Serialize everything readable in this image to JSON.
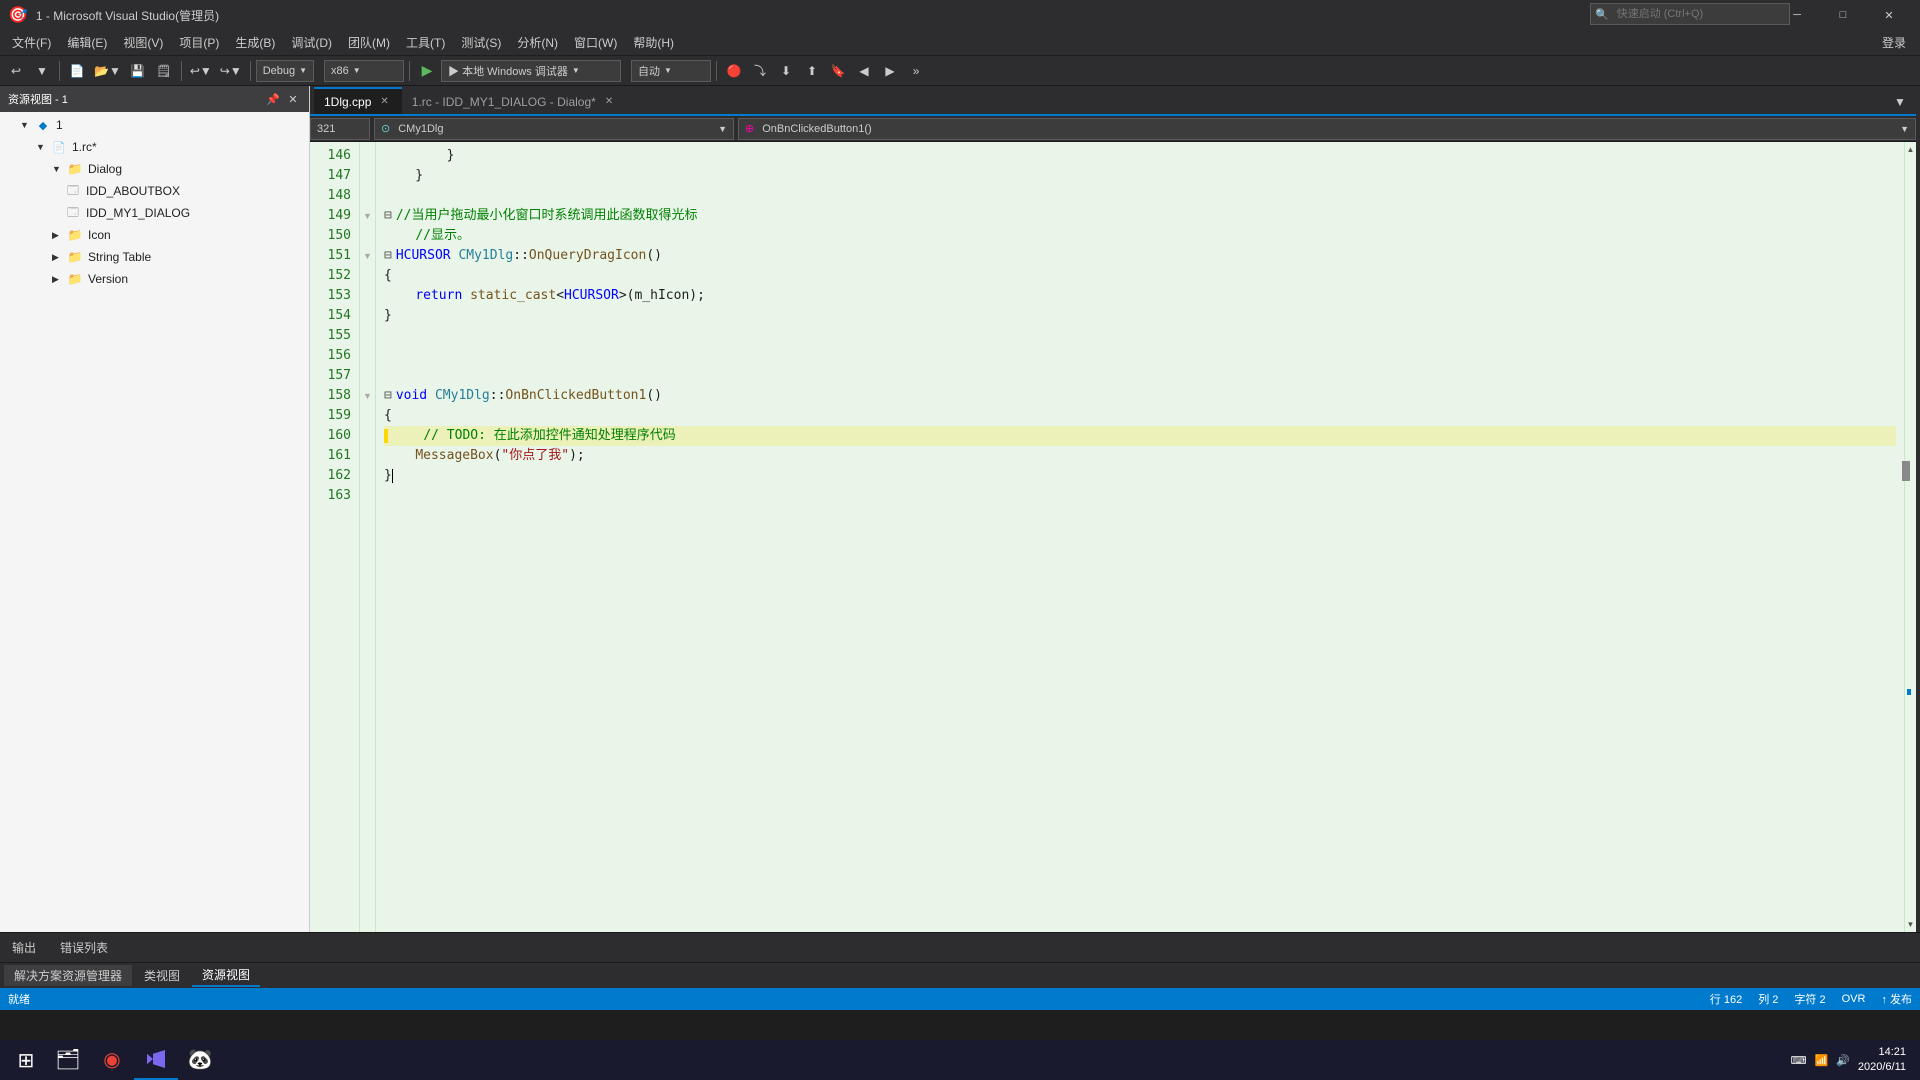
{
  "titleBar": {
    "icon": "▶",
    "title": "1 - Microsoft Visual Studio(管理员)",
    "quickLaunch": "快速启动 (Ctrl+Q)",
    "minimize": "─",
    "maximize": "□",
    "close": "✕"
  },
  "menuBar": {
    "items": [
      "文件(F)",
      "编辑(E)",
      "视图(V)",
      "项目(P)",
      "生成(B)",
      "调试(D)",
      "团队(M)",
      "工具(T)",
      "测试(S)",
      "分析(N)",
      "窗口(W)",
      "帮助(H)"
    ],
    "loginLabel": "登录"
  },
  "toolbar": {
    "debugMode": "Debug",
    "platform": "x86",
    "startLabel": "▶ 本地 Windows 调试器",
    "autoLabel": "自动"
  },
  "sidebar": {
    "title": "资源视图 - 1",
    "tree": [
      {
        "id": "root",
        "label": "1",
        "indent": 0,
        "expanded": true,
        "icon": "📁"
      },
      {
        "id": "rc",
        "label": "1.rc*",
        "indent": 1,
        "expanded": true,
        "icon": "📄"
      },
      {
        "id": "dialog",
        "label": "Dialog",
        "indent": 2,
        "expanded": true,
        "icon": "📁"
      },
      {
        "id": "idd_about",
        "label": "IDD_ABOUTBOX",
        "indent": 3,
        "expanded": false,
        "icon": "🗔"
      },
      {
        "id": "idd_my1",
        "label": "IDD_MY1_DIALOG",
        "indent": 3,
        "expanded": false,
        "icon": "🗔"
      },
      {
        "id": "icon",
        "label": "Icon",
        "indent": 2,
        "expanded": false,
        "icon": "📁"
      },
      {
        "id": "stringtable",
        "label": "String Table",
        "indent": 2,
        "expanded": false,
        "icon": "📁"
      },
      {
        "id": "version",
        "label": "Version",
        "indent": 2,
        "expanded": false,
        "icon": "📁"
      }
    ]
  },
  "tabs": [
    {
      "id": "1dlg",
      "label": "1Dlg.cpp",
      "active": true,
      "modified": false
    },
    {
      "id": "1rc",
      "label": "1.rc - IDD_MY1_DIALOG - Dialog*",
      "active": false,
      "modified": true
    }
  ],
  "navDropdowns": {
    "lineNum": "321",
    "classDropdown": "CMy1Dlg",
    "methodDropdown": "OnBnClickedButton1()"
  },
  "codeEditor": {
    "lines": [
      {
        "num": 146,
        "indent": "        ",
        "content": "}"
      },
      {
        "num": 147,
        "indent": "    ",
        "content": "}"
      },
      {
        "num": 148,
        "indent": "",
        "content": ""
      },
      {
        "num": 149,
        "indent": "",
        "content": "//当用户拖动最小化窗口时系统调用此函数取得光标",
        "comment": true,
        "fold": true
      },
      {
        "num": 150,
        "indent": "",
        "content": "//显示。",
        "comment": true
      },
      {
        "num": 151,
        "indent": "",
        "content": "HCURSOR CMy1Dlg::OnQueryDragIcon()",
        "fold": true
      },
      {
        "num": 152,
        "indent": "",
        "content": "{"
      },
      {
        "num": 153,
        "indent": "    ",
        "content": "return static_cast<HCURSOR>(m_hIcon);"
      },
      {
        "num": 154,
        "indent": "",
        "content": "}"
      },
      {
        "num": 155,
        "indent": "",
        "content": ""
      },
      {
        "num": 156,
        "indent": "",
        "content": ""
      },
      {
        "num": 157,
        "indent": "",
        "content": ""
      },
      {
        "num": 158,
        "indent": "",
        "content": "void CMy1Dlg::OnBnClickedButton1()",
        "fold": true
      },
      {
        "num": 159,
        "indent": "",
        "content": "{"
      },
      {
        "num": 160,
        "indent": "    ",
        "content": "// TODO: 在此添加控件通知处理程序代码",
        "comment": true,
        "breakpoint": true
      },
      {
        "num": 161,
        "indent": "    ",
        "content": "MessageBox(\"你点了我\");",
        "active": true
      },
      {
        "num": 162,
        "indent": "",
        "content": "}",
        "cursor": true
      },
      {
        "num": 163,
        "indent": "",
        "content": ""
      }
    ]
  },
  "bottomPanel": {
    "tabs": [
      "输出",
      "错误列表"
    ]
  },
  "statusBar": {
    "status": "就绪",
    "line": "行 162",
    "col": "列 2",
    "char": "字符 2",
    "ovr": "OVR",
    "publish": "↑ 发布"
  },
  "taskbar": {
    "apps": [
      {
        "id": "start",
        "icon": "⊞",
        "label": "Start"
      },
      {
        "id": "explorer",
        "icon": "📁",
        "label": "Explorer"
      },
      {
        "id": "chrome",
        "icon": "◉",
        "label": "Chrome"
      },
      {
        "id": "vs",
        "icon": "Ⓥ",
        "label": "Visual Studio",
        "active": true
      },
      {
        "id": "app4",
        "icon": "🐼",
        "label": "App4"
      }
    ],
    "systemTray": {
      "time": "14:21",
      "date": "2020/6/11"
    }
  }
}
